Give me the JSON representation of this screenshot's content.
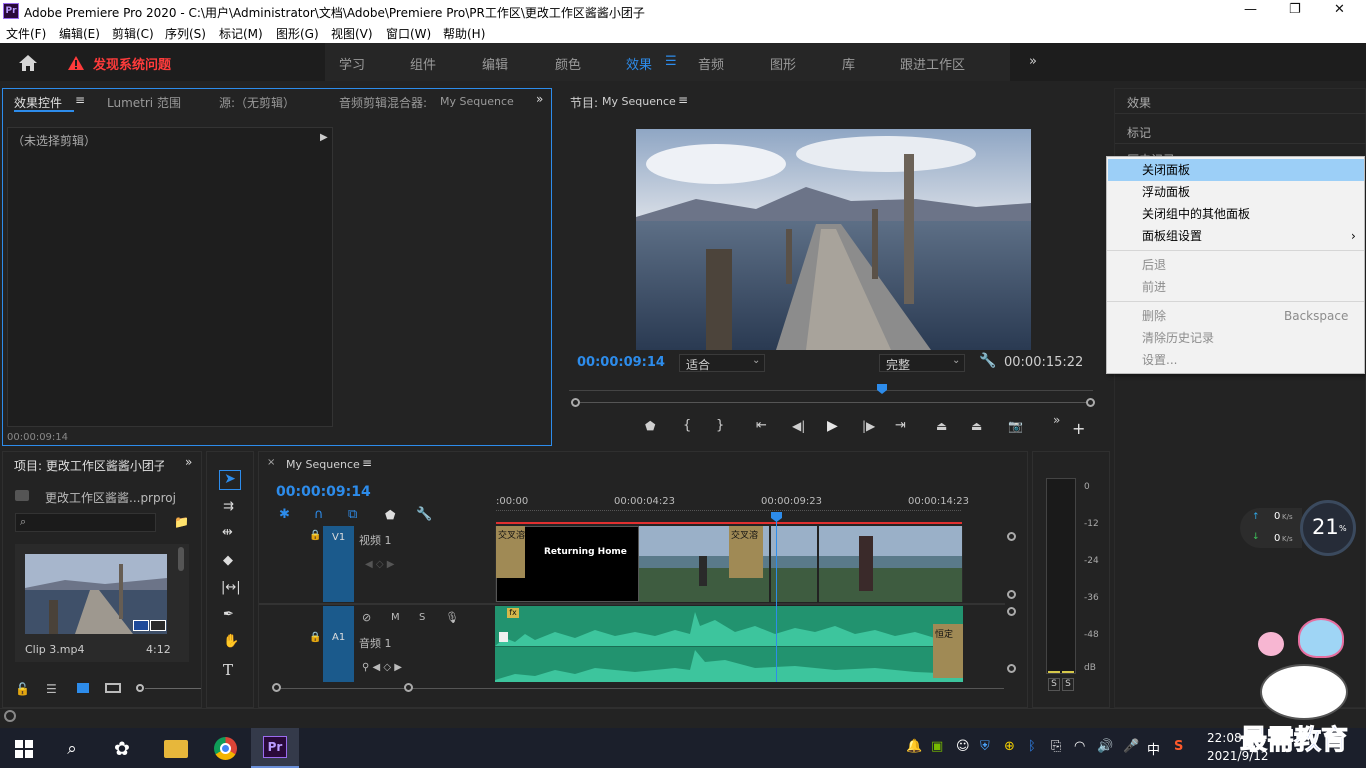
{
  "titlebar": {
    "app_icon": "Pr",
    "title": "Adobe Premiere Pro 2020 - C:\\用户\\Administrator\\文档\\Adobe\\Premiere Pro\\PR工作区\\更改工作区酱酱小团子",
    "minimize": "—",
    "maximize": "❐",
    "close": "✕"
  },
  "menubar": [
    "文件(F)",
    "编辑(E)",
    "剪辑(C)",
    "序列(S)",
    "标记(M)",
    "图形(G)",
    "视图(V)",
    "窗口(W)",
    "帮助(H)"
  ],
  "workspace": {
    "alert": "发现系统问题",
    "tabs": [
      "学习",
      "组件",
      "编辑",
      "颜色",
      "效果",
      "音频",
      "图形",
      "库",
      "跟进工作区"
    ],
    "active": "效果",
    "more": "»"
  },
  "source_panel": {
    "tabs": [
      "效果控件",
      "Lumetri 范围",
      "源:（无剪辑）",
      "音频剪辑混合器:"
    ],
    "mixer_seq": "My Sequence",
    "no_clip": "（未选择剪辑）",
    "timecode": "00:00:09:14"
  },
  "program": {
    "title": "节目:",
    "seq": "My Sequence",
    "timecode": "00:00:09:14",
    "fit": "适合",
    "quality": "完整",
    "duration": "00:00:15:22",
    "playhead_fraction": 0.6
  },
  "right_panel": {
    "items": [
      "效果",
      "标记",
      "历史记录"
    ]
  },
  "context_menu": {
    "items": [
      {
        "label": "关闭面板",
        "state": "highlight"
      },
      {
        "label": "浮动面板",
        "state": "normal"
      },
      {
        "label": "关闭组中的其他面板",
        "state": "normal"
      },
      {
        "label": "面板组设置",
        "state": "normal",
        "submenu": "›"
      },
      {
        "label": "后退",
        "state": "disabled"
      },
      {
        "label": "前进",
        "state": "disabled"
      },
      {
        "label": "删除",
        "state": "disabled",
        "shortcut": "Backspace"
      },
      {
        "label": "清除历史记录",
        "state": "disabled"
      },
      {
        "label": "设置...",
        "state": "disabled"
      }
    ]
  },
  "project": {
    "tab": "项目: 更改工作区酱酱小团子",
    "file": "更改工作区酱酱...prproj",
    "clip_name": "Clip 3.mp4",
    "clip_duration": "4:12"
  },
  "timeline": {
    "seq": "My Sequence",
    "timecode": "00:00:09:14",
    "ruler": [
      ":00:00",
      "00:00:04:23",
      "00:00:09:23",
      "00:00:14:23"
    ],
    "v1": {
      "label": "V1",
      "name": "视频 1"
    },
    "a1": {
      "label": "A1",
      "name": "音频 1",
      "m": "M",
      "s": "S"
    },
    "clips": {
      "transition": "交叉溶",
      "title": "Returning Home",
      "fx": "fx",
      "audio_end": "恒定"
    }
  },
  "meter": {
    "scale": [
      "0",
      "-12",
      "-24",
      "-36",
      "-48",
      "dB"
    ],
    "solo": [
      "S",
      "S"
    ]
  },
  "netspeed": {
    "up": "0",
    "down": "0",
    "unit": "K/s",
    "percent": "21",
    "pct_sign": "%"
  },
  "watermark": "最需教育",
  "taskbar": {
    "time": "22:08",
    "date": "2021/9/12",
    "ime": "中",
    "pr": "Pr"
  },
  "colors": {
    "accent": "#2d8ceb",
    "alert": "#ff3b3b",
    "audio": "#3dc59d",
    "track_blue": "#1b5a8c"
  }
}
